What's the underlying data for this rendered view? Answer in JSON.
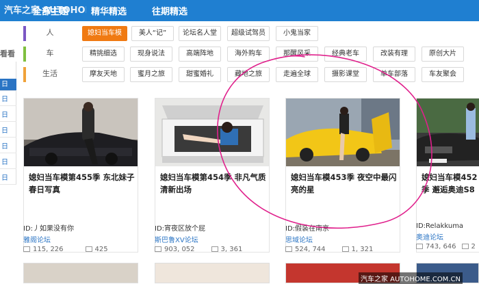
{
  "topbar": {
    "watermark": "汽车之家 AUTOHOME.COM.CN",
    "tabs": [
      "全部主题",
      "精华精选",
      "往期精选"
    ]
  },
  "leftnav": {
    "header": "看看",
    "items": [
      "日",
      "日",
      "日",
      "日",
      "日",
      "日",
      "日"
    ]
  },
  "categories": [
    {
      "label": "人",
      "color": "#7b57c4",
      "tags": [
        "媳妇当车模",
        "美人“记”",
        "论坛名人堂",
        "超级试驾员",
        "小鬼当家"
      ],
      "selected": 0
    },
    {
      "label": "车",
      "color": "#7fbf3f",
      "tags": [
        "精挑细选",
        "现身说法",
        "高端阵地",
        "海外购车",
        "那醒风采",
        "经典老车",
        "改装有理",
        "原创大片"
      ],
      "selected": -1
    },
    {
      "label": "生活",
      "color": "#f0a23a",
      "tags": [
        "摩友天地",
        "蜜月之旅",
        "甜蜜婚礼",
        "藏地之旅",
        "走遍全球",
        "摄影课堂",
        "单车部落",
        "车友聚会"
      ],
      "selected": -1
    }
  ],
  "cards": [
    {
      "title": "媳妇当车模第455季 东北妹子春日写真",
      "author": "ID:丿如果没有你",
      "forum": "雅阁论坛",
      "views": "115, 226",
      "replies": "425"
    },
    {
      "title": "媳妇当车模第454季 非凡气质清新出场",
      "author": "ID:宵夜区放个屁",
      "forum": "斯巴鲁XV论坛",
      "views": "903, 052",
      "replies": "3, 361"
    },
    {
      "title": "媳妇当车模453季 夜空中最闪亮的星",
      "author": "ID:假装在南京",
      "forum": "思域论坛",
      "views": "524, 744",
      "replies": "1, 321"
    },
    {
      "title": "媳妇当车模452季 邂逅奥迪S8",
      "author": "ID:Relakkuma",
      "forum": "奥迪论坛",
      "views": "743, 646",
      "replies": "2"
    }
  ],
  "bottom_watermark": "汽车之家 AUTOHOME.COM.CN",
  "colors": {
    "accent": "#1f7fd1",
    "selected": "#f07a12",
    "annotation": "#e0208c"
  }
}
